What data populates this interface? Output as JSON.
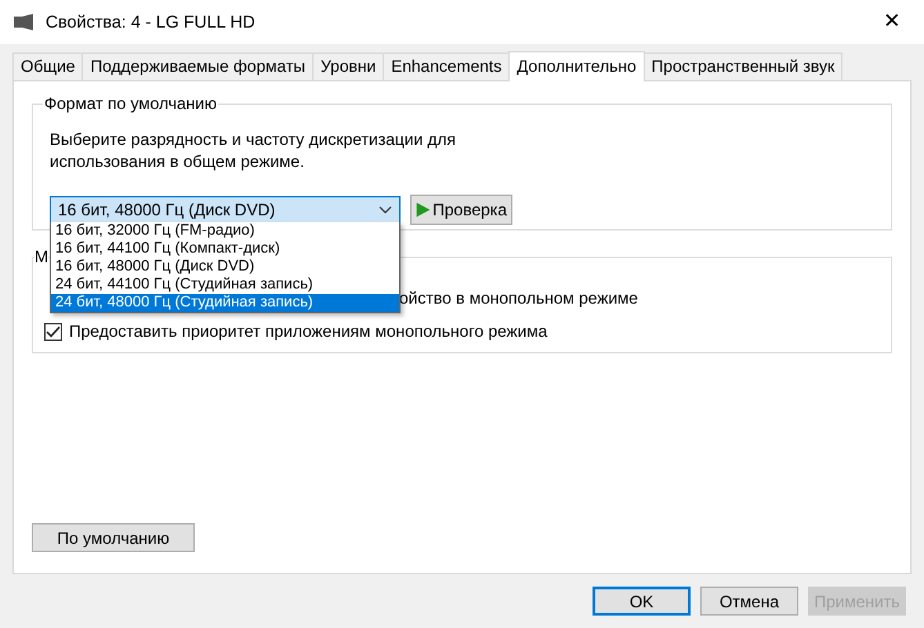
{
  "window": {
    "title": "Свойства: 4 - LG FULL HD",
    "close": "✕"
  },
  "tabs": [
    {
      "label": "Общие",
      "selected": false
    },
    {
      "label": "Поддерживаемые форматы",
      "selected": false
    },
    {
      "label": "Уровни",
      "selected": false
    },
    {
      "label": "Enhancements",
      "selected": false
    },
    {
      "label": "Дополнительно",
      "selected": true
    },
    {
      "label": "Пространственный звук",
      "selected": false
    }
  ],
  "default_format": {
    "legend": "Формат по умолчанию",
    "description": "Выберите разрядность и частоту дискретизации для использования в общем режиме.",
    "dropdown": {
      "value": "16 бит, 48000 Гц (Диск DVD)",
      "expanded": true,
      "options": [
        {
          "label": "16 бит, 32000 Гц (FM-радио)",
          "highlighted": false
        },
        {
          "label": "16 бит, 44100 Гц (Компакт-диск)",
          "highlighted": false
        },
        {
          "label": "16 бит, 48000 Гц (Диск DVD)",
          "highlighted": false
        },
        {
          "label": "24 бит, 44100 Гц (Студийная запись)",
          "highlighted": false
        },
        {
          "label": "24 бит, 48000 Гц (Студийная запись)",
          "highlighted": true
        }
      ]
    },
    "test_button": "Проверка"
  },
  "exclusive_mode": {
    "legend": "М",
    "options": [
      {
        "label": "ойство в монопольном режиме",
        "kind": "partial"
      },
      {
        "label": "Предоставить приоритет приложениям монопольного режима",
        "kind": "checkbox",
        "checked": true
      }
    ]
  },
  "restore_button": "По умолчанию",
  "buttons": [
    {
      "label": "OK",
      "default": true,
      "disabled": false
    },
    {
      "label": "Отмена",
      "default": false,
      "disabled": false
    },
    {
      "label": "Применить",
      "default": false,
      "disabled": true
    }
  ]
}
